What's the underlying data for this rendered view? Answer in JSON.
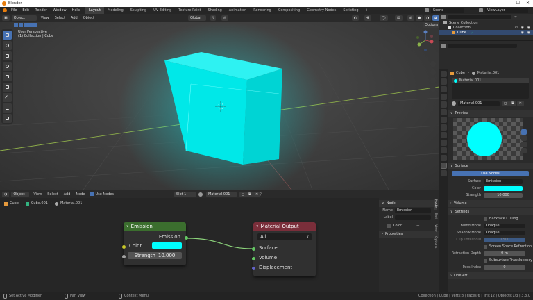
{
  "window": {
    "title": "Blender"
  },
  "menu": [
    "File",
    "Edit",
    "Render",
    "Window",
    "Help"
  ],
  "workspaces": [
    "Layout",
    "Modeling",
    "Sculpting",
    "UV Editing",
    "Texture Paint",
    "Shading",
    "Animation",
    "Rendering",
    "Compositing",
    "Geometry Nodes",
    "Scripting"
  ],
  "topright": {
    "scene": "Scene",
    "viewlayer": "ViewLayer"
  },
  "viewport": {
    "mode": "Object Mode",
    "menus": [
      "View",
      "Select",
      "Add",
      "Object"
    ],
    "transform": "Global",
    "options": "Options",
    "overlay_title": "User Perspective",
    "overlay_sub": "(1) Collection | Cube"
  },
  "colors": {
    "emission": "#00ffff",
    "node_emission": "#3b6e2e",
    "node_output": "#7a2e3a",
    "accent": "#4772b3"
  },
  "node_editor": {
    "mode": "Object",
    "menus": [
      "View",
      "Select",
      "Add",
      "Node"
    ],
    "use_nodes": "Use Nodes",
    "slot": "Slot 1",
    "material": "Material.001",
    "breadcrumb": [
      "Cube",
      "Cube.001",
      "Material.001"
    ],
    "emission": {
      "title": "Emission",
      "out": "Emission",
      "color": "Color",
      "strength_label": "Strength",
      "strength": "10.000"
    },
    "output": {
      "title": "Material Output",
      "target": "All",
      "inputs": [
        "Surface",
        "Volume",
        "Displacement"
      ]
    },
    "side": {
      "node": "Node",
      "name_label": "Name",
      "name": "Emission",
      "label_label": "Label",
      "color": "Color",
      "properties": "Properties",
      "tabs": [
        "Node",
        "Tool",
        "View",
        "Options"
      ]
    }
  },
  "outliner": {
    "scene_collection": "Scene Collection",
    "collection": "Collection",
    "cube": "Cube"
  },
  "properties": {
    "breadcrumb": [
      "Cube",
      "Material.001"
    ],
    "slot": "Material.001",
    "material": "Material.001",
    "preview": "Preview",
    "surface": "Surface",
    "use_nodes": "Use Nodes",
    "surface_label": "Surface",
    "surface_val": "Emission",
    "color_label": "Color",
    "strength_label": "Strength",
    "strength": "10.000",
    "volume": "Volume",
    "settings": "Settings",
    "backface": "Backface Culling",
    "blend_label": "Blend Mode",
    "blend": "Opaque",
    "shadow_label": "Shadow Mode",
    "shadow": "Opaque",
    "clip_label": "Clip Threshold",
    "clip": "0.500",
    "ssr": "Screen Space Refraction",
    "refr_label": "Refraction Depth",
    "refr": "0 m",
    "sss": "Subsurface Translucency",
    "pass_label": "Pass Index",
    "pass": "0",
    "lineart": "Line Art"
  },
  "status": {
    "left1": "Set Active Modifier",
    "left2": "Pan View",
    "left3": "Context Menu",
    "right": "Collection | Cube | Verts:8 | Faces:6 | Tris:12 | Objects:1/3 | 3.3.0"
  }
}
